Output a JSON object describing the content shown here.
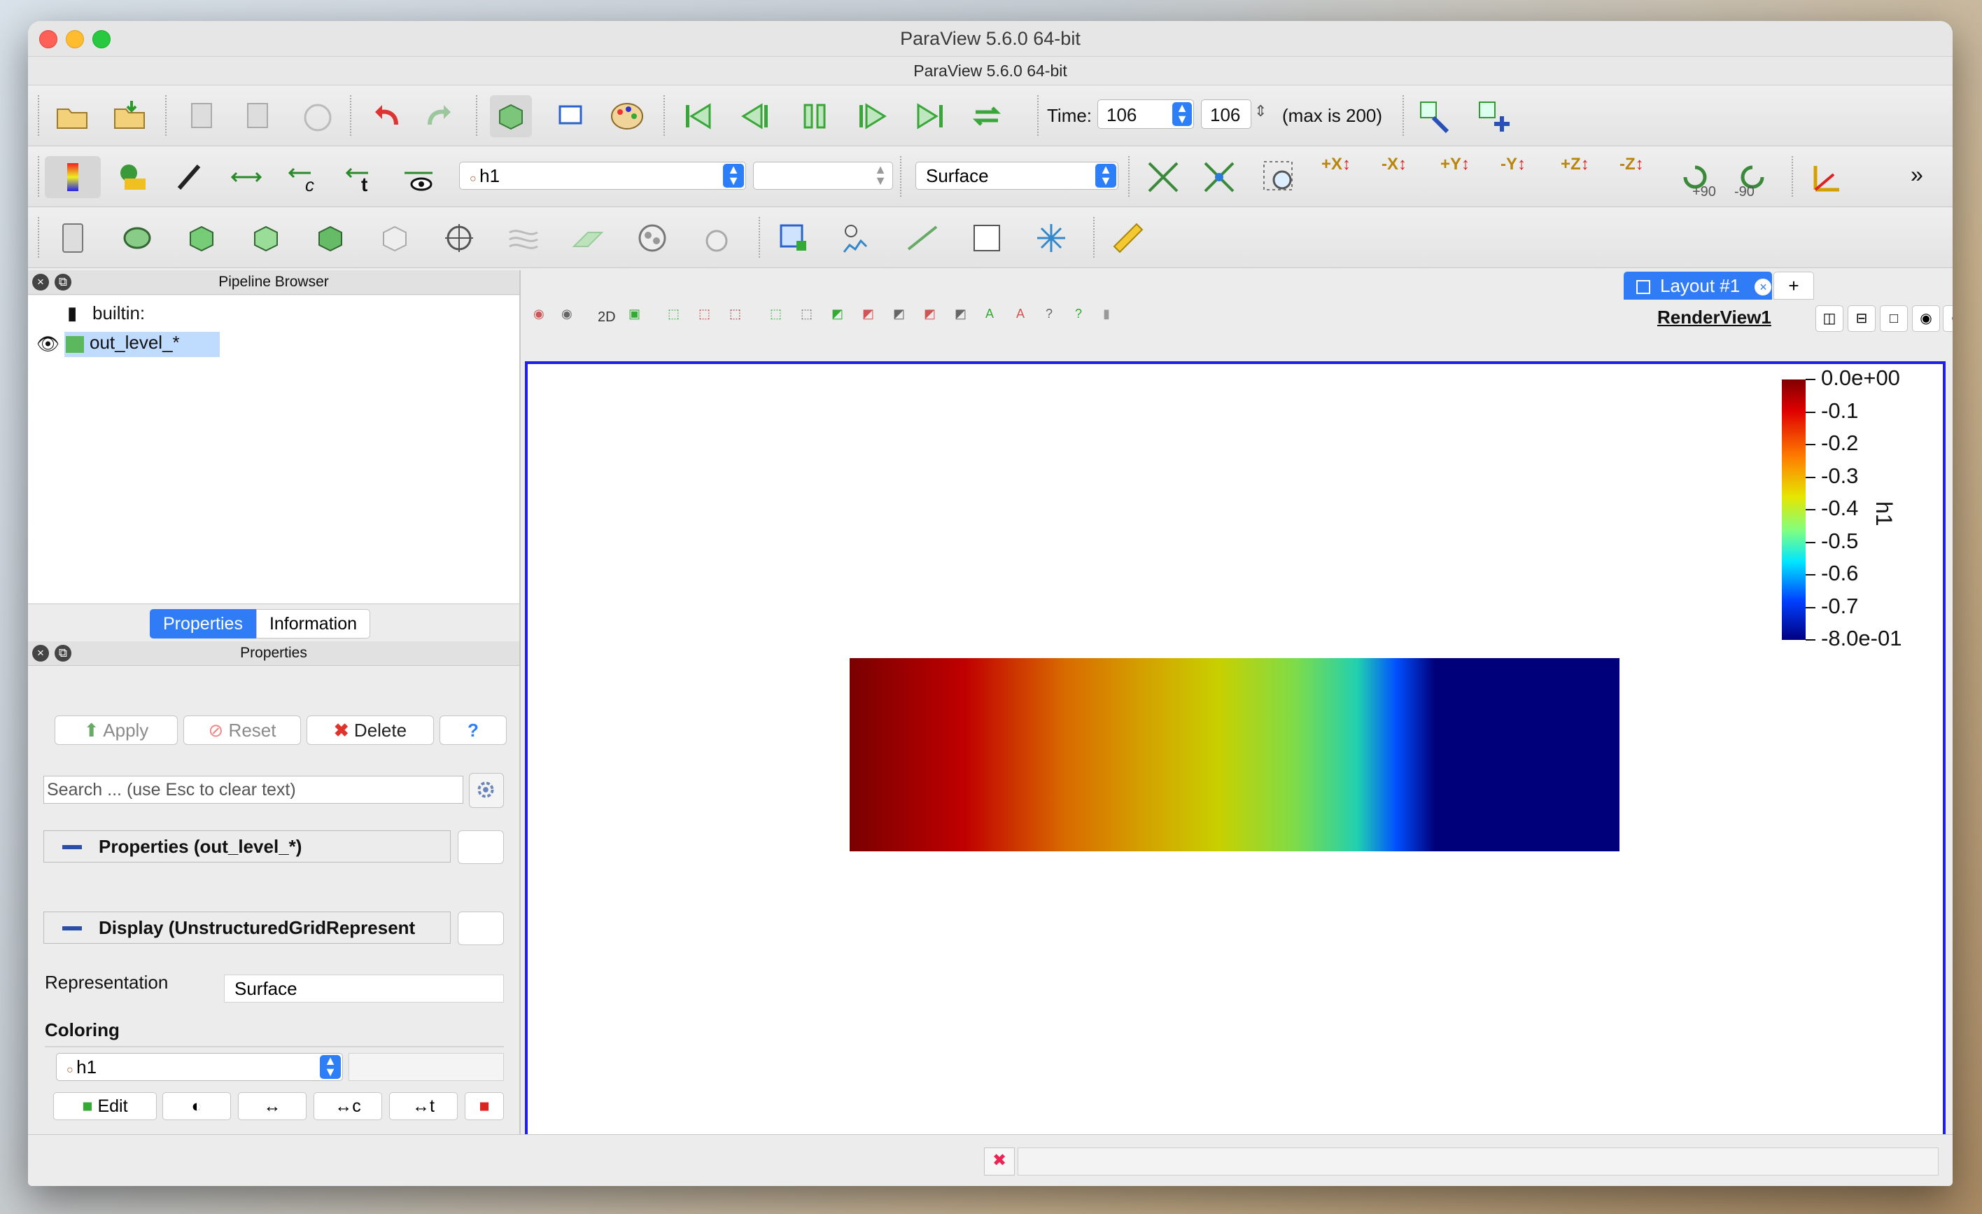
{
  "window": {
    "title": "ParaView 5.6.0 64-bit",
    "subtitle": "ParaView 5.6.0 64-bit"
  },
  "time": {
    "label": "Time:",
    "value": "106",
    "step": "106",
    "max_text": "(max is 200)"
  },
  "toolbar2": {
    "array": "h1",
    "representation": "Surface",
    "rot_plus": "+90",
    "rot_minus": "-90",
    "more": "»",
    "axes": [
      "+X",
      "-X",
      "+Y",
      "-Y",
      "+Z",
      "-Z"
    ]
  },
  "pipeline": {
    "title": "Pipeline Browser",
    "root": "builtin:",
    "item": "out_level_*"
  },
  "tabs": {
    "properties": "Properties",
    "information": "Information"
  },
  "properties": {
    "title": "Properties",
    "apply": "Apply",
    "reset": "Reset",
    "delete": "Delete",
    "help": "?",
    "search_placeholder": "Search ... (use Esc to clear text)",
    "section_props": "Properties (out_level_*)",
    "section_display": "Display (UnstructuredGridRepresent",
    "representation_label": "Representation",
    "representation_value": "Surface",
    "coloring_label": "Coloring",
    "coloring_array": "h1",
    "edit": "Edit"
  },
  "view": {
    "layout_tab": "Layout #1",
    "plus_tab": "+",
    "twod": "2D",
    "render_view": "RenderView1"
  },
  "colorbar": {
    "title": "h1",
    "labels": [
      "0.0e+00",
      "-0.1",
      "-0.2",
      "-0.3",
      "-0.4",
      "-0.5",
      "-0.6",
      "-0.7",
      "-8.0e-01"
    ]
  },
  "colors": {
    "accent": "#2f7cf6",
    "render_border": "#1f1fe6"
  }
}
